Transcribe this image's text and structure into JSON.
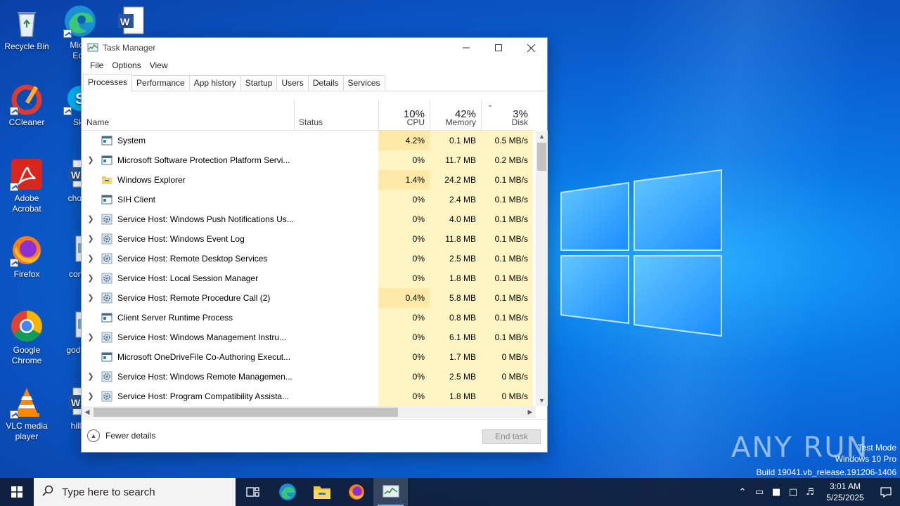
{
  "desktop": {
    "icons": [
      {
        "label": "Recycle Bin"
      },
      {
        "label": "Micro\nEdg"
      },
      {
        "label": ""
      },
      {
        "label": "CCleaner"
      },
      {
        "label": "Sky"
      },
      {
        "label": "Adobe\nAcrobat"
      },
      {
        "label": "choice"
      },
      {
        "label": "Firefox"
      },
      {
        "label": "comin"
      },
      {
        "label": "Google\nChrome"
      },
      {
        "label": "godsub"
      },
      {
        "label": "VLC media\nplayer"
      },
      {
        "label": "hillsit"
      }
    ]
  },
  "window": {
    "title": "Task Manager",
    "menu": [
      "File",
      "Options",
      "View"
    ],
    "tabs": [
      "Processes",
      "Performance",
      "App history",
      "Startup",
      "Users",
      "Details",
      "Services"
    ],
    "active_tab": "Processes",
    "columns": {
      "name": "Name",
      "status": "Status",
      "cpu": {
        "pct": "10%",
        "label": "CPU"
      },
      "memory": {
        "pct": "42%",
        "label": "Memory"
      },
      "disk": {
        "pct": "3%",
        "label": "Disk"
      }
    },
    "rows": [
      {
        "name": "System",
        "expandable": false,
        "icon": "app-window-icon",
        "cpu": "4.2%",
        "mem": "0.1 MB",
        "disk": "0.5 MB/s"
      },
      {
        "name": "Microsoft Software Protection Platform Servi...",
        "expandable": true,
        "icon": "app-window-icon",
        "cpu": "0%",
        "mem": "11.7 MB",
        "disk": "0.2 MB/s"
      },
      {
        "name": "Windows Explorer",
        "expandable": false,
        "icon": "folder-icon",
        "cpu": "1.4%",
        "mem": "24.2 MB",
        "disk": "0.1 MB/s"
      },
      {
        "name": "SIH Client",
        "expandable": false,
        "icon": "app-window-icon",
        "cpu": "0%",
        "mem": "2.4 MB",
        "disk": "0.1 MB/s"
      },
      {
        "name": "Service Host: Windows Push Notifications Us...",
        "expandable": true,
        "icon": "gear-icon",
        "cpu": "0%",
        "mem": "4.0 MB",
        "disk": "0.1 MB/s"
      },
      {
        "name": "Service Host: Windows Event Log",
        "expandable": true,
        "icon": "gear-icon",
        "cpu": "0%",
        "mem": "11.8 MB",
        "disk": "0.1 MB/s"
      },
      {
        "name": "Service Host: Remote Desktop Services",
        "expandable": true,
        "icon": "gear-icon",
        "cpu": "0%",
        "mem": "2.5 MB",
        "disk": "0.1 MB/s"
      },
      {
        "name": "Service Host: Local Session Manager",
        "expandable": true,
        "icon": "gear-icon",
        "cpu": "0%",
        "mem": "1.8 MB",
        "disk": "0.1 MB/s"
      },
      {
        "name": "Service Host: Remote Procedure Call (2)",
        "expandable": true,
        "icon": "gear-icon",
        "cpu": "0.4%",
        "mem": "5.8 MB",
        "disk": "0.1 MB/s"
      },
      {
        "name": "Client Server Runtime Process",
        "expandable": false,
        "icon": "app-window-icon",
        "cpu": "0%",
        "mem": "0.8 MB",
        "disk": "0.1 MB/s"
      },
      {
        "name": "Service Host: Windows Management Instru...",
        "expandable": true,
        "icon": "gear-icon",
        "cpu": "0%",
        "mem": "6.1 MB",
        "disk": "0.1 MB/s"
      },
      {
        "name": "Microsoft OneDriveFile Co-Authoring Execut...",
        "expandable": false,
        "icon": "app-window-icon",
        "cpu": "0%",
        "mem": "1.7 MB",
        "disk": "0 MB/s"
      },
      {
        "name": "Service Host: Windows Remote Managemen...",
        "expandable": true,
        "icon": "gear-icon",
        "cpu": "0%",
        "mem": "2.5 MB",
        "disk": "0 MB/s"
      },
      {
        "name": "Service Host: Program Compatibility Assista...",
        "expandable": true,
        "icon": "gear-icon",
        "cpu": "0%",
        "mem": "1.8 MB",
        "disk": "0 MB/s"
      }
    ],
    "footer": {
      "fewer_details": "Fewer details",
      "end_task": "End task"
    }
  },
  "watermark": {
    "logo": "ANY RUN",
    "line1": "Test Mode",
    "line2": "Windows 10 Pro",
    "line3": "Build 19041.vb_release.191206-1406"
  },
  "taskbar": {
    "search_placeholder": "Type here to search",
    "time": "3:01 AM",
    "date": "5/25/2025"
  },
  "colors": {
    "accent": "#0a78e6",
    "cpu_heat_low": "#fff4c4",
    "cpu_heat_mid": "#ffe9a8"
  }
}
